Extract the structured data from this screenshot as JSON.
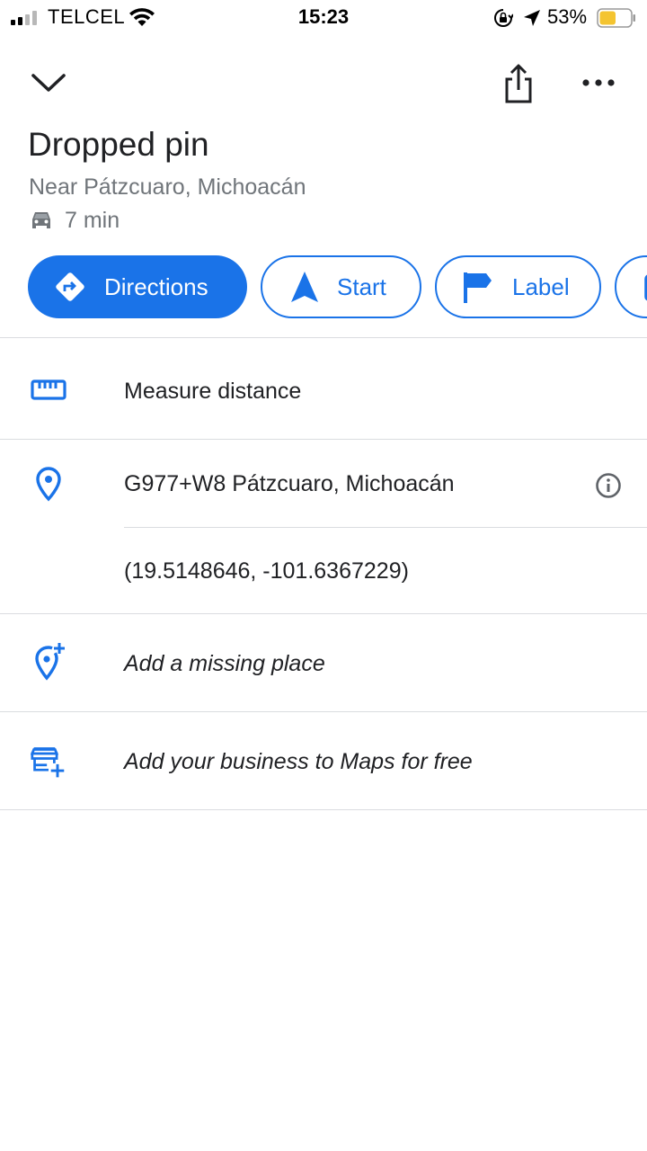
{
  "status_bar": {
    "carrier": "TELCEL",
    "time": "15:23",
    "battery": "53%",
    "battery_level": 0.53,
    "signal_bars": 2
  },
  "header": {
    "collapse_icon": "chevron-down-icon",
    "share_icon": "share-icon",
    "more_icon": "more-horizontal-icon"
  },
  "place": {
    "title": "Dropped pin",
    "subtitle": "Near Pátzcuaro, Michoacán",
    "drive_time": "7 min"
  },
  "actions": {
    "directions": "Directions",
    "start": "Start",
    "label": "Label"
  },
  "rows": {
    "measure": "Measure distance",
    "plus_code": "G977+W8 Pátzcuaro, Michoacán",
    "coordinates": "(19.5148646, -101.6367229)",
    "add_place": "Add a missing place",
    "add_business": "Add your business to Maps for free"
  },
  "colors": {
    "accent": "#1a73e8",
    "secondary_text": "#70757a",
    "divider": "#dadce0",
    "battery_fill": "#f4c430"
  }
}
